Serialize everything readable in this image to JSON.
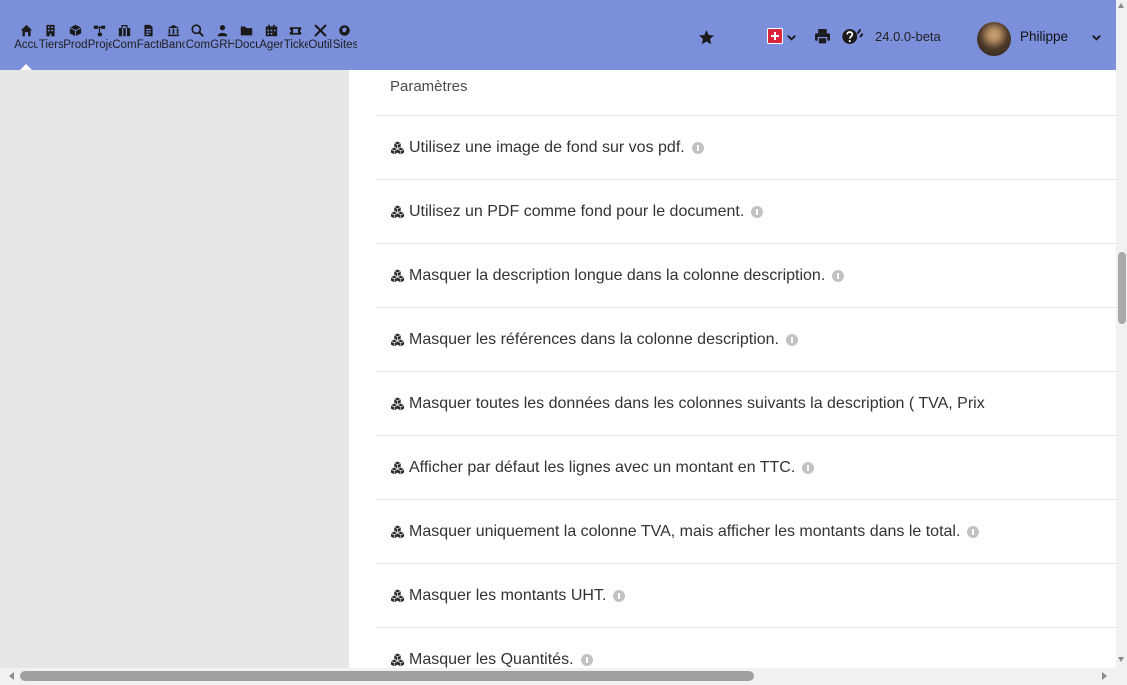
{
  "menu": [
    {
      "label": "Accu",
      "icon": "home-icon"
    },
    {
      "label": "Tiers",
      "icon": "building-icon"
    },
    {
      "label": "Prod",
      "icon": "cube-icon"
    },
    {
      "label": "Proje",
      "icon": "sitemap-icon"
    },
    {
      "label": "Com",
      "icon": "suitcase-icon"
    },
    {
      "label": "Factu",
      "icon": "invoice-icon"
    },
    {
      "label": "Banc",
      "icon": "bank-icon"
    },
    {
      "label": "Com",
      "icon": "search-dollar-icon"
    },
    {
      "label": "GRH",
      "icon": "users-icon"
    },
    {
      "label": "Docu",
      "icon": "folder-icon"
    },
    {
      "label": "Ager",
      "icon": "calendar-icon"
    },
    {
      "label": "Ticke",
      "icon": "ticket-icon"
    },
    {
      "label": "Outil",
      "icon": "tools-icon"
    },
    {
      "label": "Sites",
      "icon": "globe-icon"
    }
  ],
  "topbar": {
    "version": "24.0.0-beta",
    "username": "Philippe",
    "bookmark_icon": "star-icon",
    "print_icon": "print-icon",
    "help_icon": "help-icon"
  },
  "colors": {
    "topbar": "#7b8fdb",
    "left_panel": "#e6e6e6",
    "flag": "#d7263d"
  },
  "content": {
    "section_title": "Paramètres",
    "rows": [
      {
        "text": "Utilisez une image de fond sur vos pdf.",
        "info": true
      },
      {
        "text": "Utilisez un PDF comme fond pour le document.",
        "info": true
      },
      {
        "text": "Masquer la description longue dans la colonne description.",
        "info": true
      },
      {
        "text": "Masquer les références dans la colonne description.",
        "info": true
      },
      {
        "text": "Masquer toutes les données dans les colonnes suivants la description ( TVA, Prix",
        "info": false
      },
      {
        "text": "Afficher par défaut les lignes avec un montant en TTC.",
        "info": true
      },
      {
        "text": "Masquer uniquement la colonne TVA, mais afficher les montants dans le total.",
        "info": true
      },
      {
        "text": "Masquer les montants UHT.",
        "info": true
      },
      {
        "text": "Masquer les Quantités.",
        "info": true
      }
    ]
  }
}
